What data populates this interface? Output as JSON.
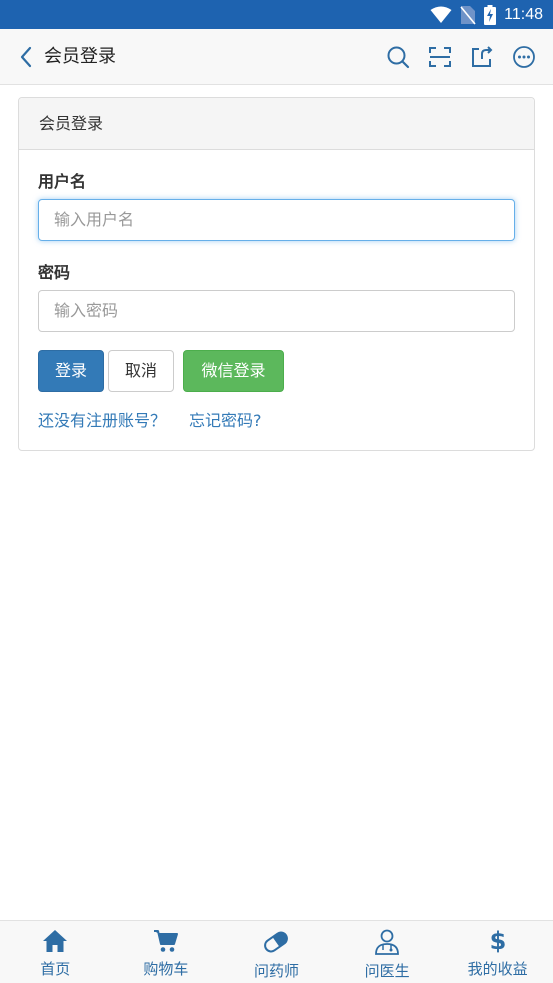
{
  "status_bar": {
    "time": "11:48"
  },
  "header": {
    "title": "会员登录"
  },
  "panel": {
    "heading": "会员登录",
    "username_label": "用户名",
    "username_placeholder": "输入用户名",
    "password_label": "密码",
    "password_placeholder": "输入密码",
    "login_button": "登录",
    "cancel_button": "取消",
    "wechat_login_button": "微信登录",
    "register_link": "还没有注册账号？",
    "forgot_link": "忘记密码?"
  },
  "tabbar": {
    "items": [
      {
        "label": "首页",
        "icon": "home-icon"
      },
      {
        "label": "购物车",
        "icon": "cart-icon"
      },
      {
        "label": "问药师",
        "icon": "pill-icon"
      },
      {
        "label": "问医生",
        "icon": "doctor-icon"
      },
      {
        "label": "我的收益",
        "icon": "dollar-icon"
      }
    ]
  },
  "colors": {
    "status_bar": "#1e63b0",
    "primary": "#337ab7",
    "success": "#5cb85c",
    "tab_icon": "#2e6da4"
  }
}
